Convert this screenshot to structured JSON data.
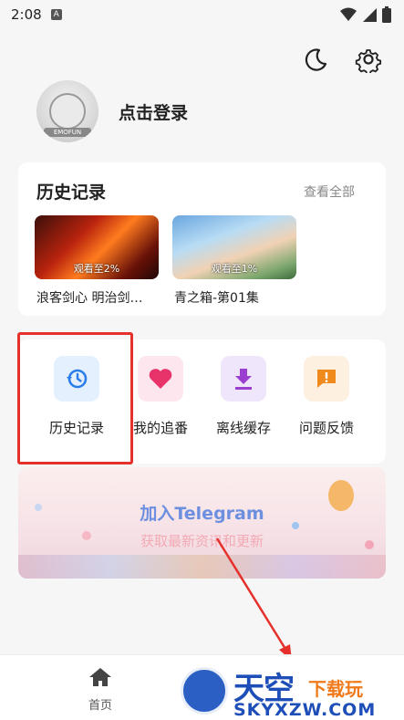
{
  "status_bar": {
    "time": "2:08",
    "notif_letter": "A"
  },
  "profile": {
    "login_label": "点击登录",
    "avatar_tag": "EMOFUN"
  },
  "history": {
    "title": "历史记录",
    "more_label": "查看全部",
    "items": [
      {
        "caption": "浪客剑心 明治剑…",
        "progress": "观看至2%"
      },
      {
        "caption": "青之箱-第01集",
        "progress": "观看至1%"
      }
    ]
  },
  "menu": {
    "items": [
      {
        "label": "历史记录",
        "icon": "history-icon"
      },
      {
        "label": "我的追番",
        "icon": "heart-icon"
      },
      {
        "label": "离线缓存",
        "icon": "download-icon"
      },
      {
        "label": "问题反馈",
        "icon": "feedback-icon"
      }
    ]
  },
  "banner": {
    "title": "加入Telegram",
    "subtitle": "获取最新资讯和更新"
  },
  "bottom_nav": {
    "home_label": "首页"
  },
  "watermark": {
    "brand_main": "天空",
    "brand_sub": "下载玩",
    "url": "SKYXZW.COM"
  },
  "colors": {
    "accent_blue": "#2b7de9",
    "highlight_red": "#e5302b"
  }
}
